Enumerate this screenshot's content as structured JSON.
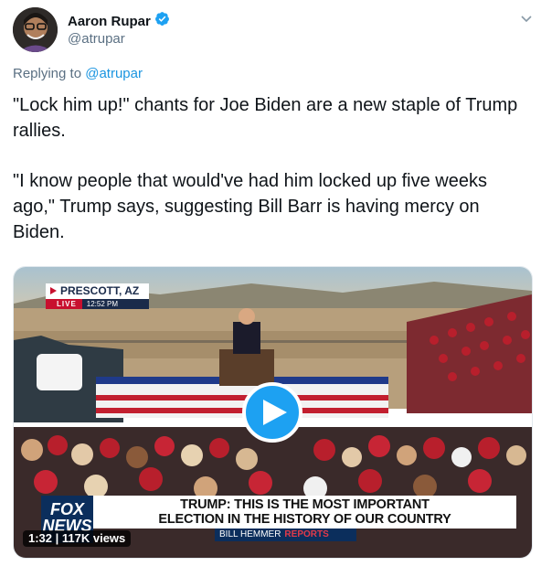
{
  "author": {
    "name": "Aaron Rupar",
    "handle": "@atrupar",
    "verified": true
  },
  "reply": {
    "prefix": "Replying to ",
    "mention": "@atrupar"
  },
  "tweet": {
    "paragraph1": "\"Lock him up!\" chants for Joe Biden are a new staple of Trump rallies.",
    "paragraph2": "\"I know people that would've had him locked up five weeks ago,\" Trump says, suggesting Bill Barr is having mercy on Biden."
  },
  "video": {
    "location": "PRESCOTT, AZ",
    "live_label": "LIVE",
    "time": "12:52 PM",
    "network_line1": "FOX",
    "network_line2": "NEWS",
    "headline_line1": "TRUMP: THIS IS THE MOST IMPORTANT",
    "headline_line2": "ELECTION IN THE HISTORY OF OUR COUNTRY",
    "anchor": "BILL HEMMER",
    "anchor_suffix": "REPORTS",
    "duration_views": "1:32 | 117K views"
  },
  "colors": {
    "accent": "#1da1f2",
    "link": "#1b95e0",
    "secondary_text": "#5b7083"
  },
  "icons": [
    "verified-badge-icon",
    "chevron-down-icon",
    "play-icon"
  ]
}
